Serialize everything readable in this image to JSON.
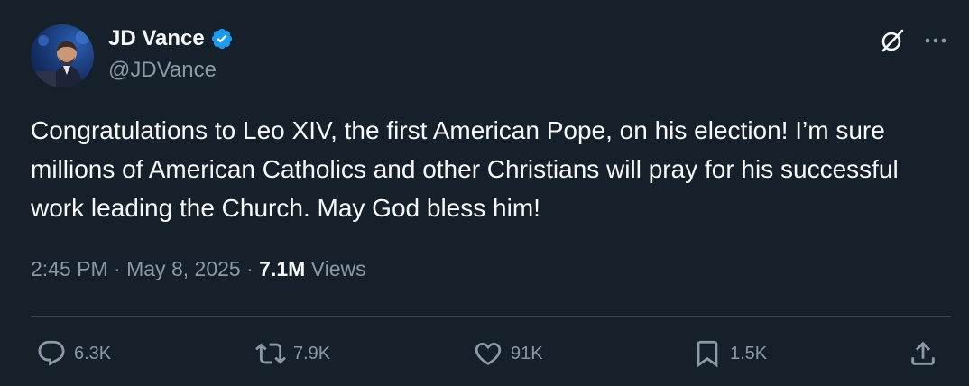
{
  "author": {
    "display_name": "JD Vance",
    "handle": "@JDVance",
    "verified_icon": "verified-badge-icon"
  },
  "tweet": {
    "text": "Congratulations to Leo XIV, the first American Pope, on his election! I’m sure millions of American Catholics and other Christians will pray for his successful work leading the Church. May God bless him!",
    "time": "2:45 PM",
    "separator": " · ",
    "date": "May 8, 2025",
    "views_count": "7.1M",
    "views_label": " Views"
  },
  "actions": {
    "replies": "6.3K",
    "reposts": "7.9K",
    "likes": "91K",
    "bookmarks": "1.5K"
  },
  "colors": {
    "background": "#15202b",
    "text": "#f7f9f9",
    "secondary": "#8b98a5",
    "verified": "#1d9bf0",
    "divider": "#38444d"
  }
}
